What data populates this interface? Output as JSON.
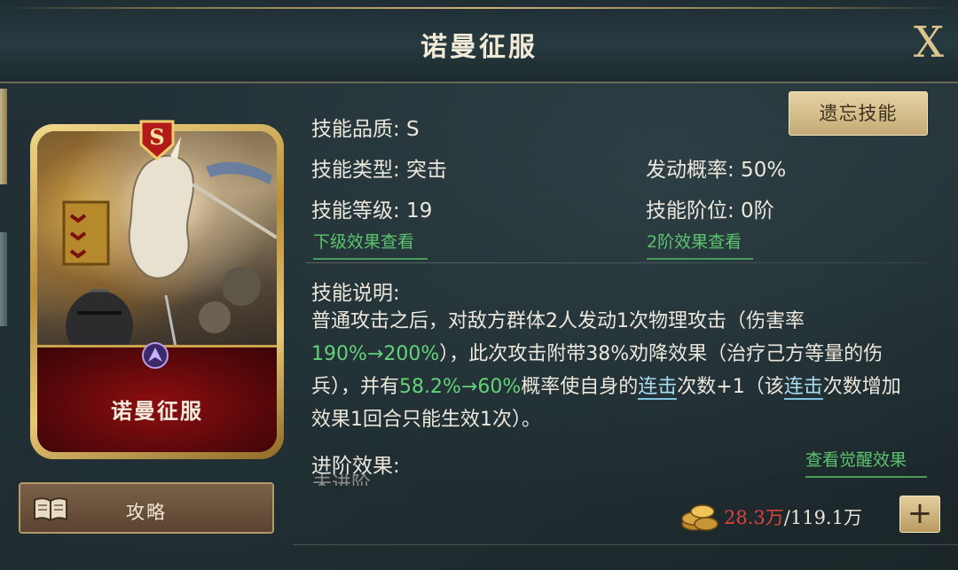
{
  "header": {
    "title": "诺曼征服",
    "close_label": "X"
  },
  "card": {
    "rank": "S",
    "name": "诺曼征服"
  },
  "guide_button": {
    "label": "攻略"
  },
  "forget_button": {
    "label": "遗忘技能"
  },
  "skill_info": {
    "quality": "技能品质: S",
    "type": "技能类型: 突击",
    "level": "技能等级: 19",
    "trigger_rate": "发动概率: 50%",
    "tier": "技能阶位: 0阶",
    "lower_effect_link": "下级效果查看",
    "tier2_effect_link": "2阶效果查看"
  },
  "description": {
    "heading": "技能说明:",
    "p1": "普通攻击之后，对敌方群体2人发动1次物理攻击（伤害率",
    "v1": "190%→200%",
    "p2": "），此次攻击附带38%劝降效果（治疗己方等量的伤兵），并有",
    "v2": "58.2%→60%",
    "p3": "概率使自身的",
    "kw1": "连击",
    "p4": "次数+1（该",
    "kw2": "连击",
    "p5": "次数增加效果1回合只能生效1次）。"
  },
  "advance": {
    "heading": "进阶效果:",
    "awaken_link": "查看觉醒效果",
    "cut_text": "未进阶"
  },
  "currency": {
    "have": "28.3万",
    "separator": "/",
    "total": "119.1万",
    "plus_label": "+"
  },
  "colors": {
    "highlight": "#63d377",
    "keyword": "#a9dcf0",
    "have": "#e0423c",
    "gold": "#c9a34d"
  }
}
